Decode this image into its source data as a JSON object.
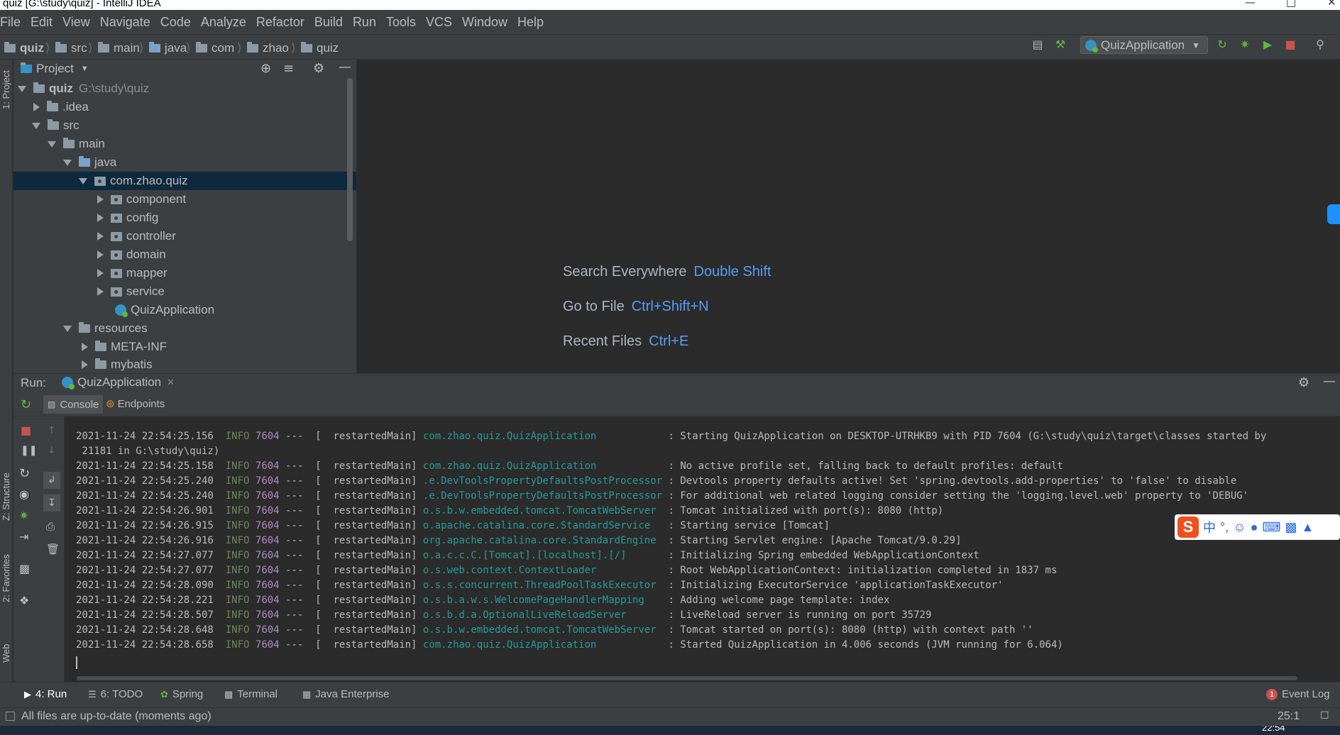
{
  "window": {
    "title": "quiz [G:\\study\\quiz] - IntelliJ IDEA"
  },
  "menu": [
    "File",
    "Edit",
    "View",
    "Navigate",
    "Code",
    "Analyze",
    "Refactor",
    "Build",
    "Run",
    "Tools",
    "VCS",
    "Window",
    "Help"
  ],
  "breadcrumb": [
    "quiz",
    "src",
    "main",
    "java",
    "com",
    "zhao",
    "quiz"
  ],
  "run_config": {
    "name": "QuizApplication"
  },
  "left_stripe": {
    "project": "1: Project",
    "structure": "Z: Structure",
    "favorites": "2: Favorites",
    "web": "Web"
  },
  "project_panel": {
    "title": "Project",
    "tree": [
      {
        "label": "quiz",
        "path": "G:\\study\\quiz"
      },
      {
        "label": ".idea"
      },
      {
        "label": "src"
      },
      {
        "label": "main"
      },
      {
        "label": "java"
      },
      {
        "label": "com.zhao.quiz"
      },
      {
        "label": "component"
      },
      {
        "label": "config"
      },
      {
        "label": "controller"
      },
      {
        "label": "domain"
      },
      {
        "label": "mapper"
      },
      {
        "label": "service"
      },
      {
        "label": "QuizApplication"
      },
      {
        "label": "resources"
      },
      {
        "label": "META-INF"
      },
      {
        "label": "mybatis"
      }
    ]
  },
  "editor_hints": [
    {
      "label": "Search Everywhere",
      "shortcut": "Double Shift"
    },
    {
      "label": "Go to File",
      "shortcut": "Ctrl+Shift+N"
    },
    {
      "label": "Recent Files",
      "shortcut": "Ctrl+E"
    }
  ],
  "run_panel": {
    "label": "Run:",
    "tab": "QuizApplication",
    "subtabs": [
      "Console",
      "Endpoints"
    ]
  },
  "console": [
    {
      "ts": "2021-11-24 22:54:25.156",
      "level": "INFO",
      "pid": "7604",
      "thread": "---  [  restartedMain]",
      "logger": "com.zhao.quiz.QuizApplication",
      "msg": ": Starting QuizApplication on DESKTOP-UTRHKB9 with PID 7604 (G:\\study\\quiz\\target\\classes started by"
    },
    {
      "cont": " 21181 in G:\\study\\quiz)"
    },
    {
      "ts": "2021-11-24 22:54:25.158",
      "level": "INFO",
      "pid": "7604",
      "thread": "---  [  restartedMain]",
      "logger": "com.zhao.quiz.QuizApplication",
      "msg": ": No active profile set, falling back to default profiles: default"
    },
    {
      "ts": "2021-11-24 22:54:25.240",
      "level": "INFO",
      "pid": "7604",
      "thread": "---  [  restartedMain]",
      "logger": ".e.DevToolsPropertyDefaultsPostProcessor",
      "msg": ": Devtools property defaults active! Set 'spring.devtools.add-properties' to 'false' to disable"
    },
    {
      "ts": "2021-11-24 22:54:25.240",
      "level": "INFO",
      "pid": "7604",
      "thread": "---  [  restartedMain]",
      "logger": ".e.DevToolsPropertyDefaultsPostProcessor",
      "msg": ": For additional web related logging consider setting the 'logging.level.web' property to 'DEBUG'"
    },
    {
      "ts": "2021-11-24 22:54:26.901",
      "level": "INFO",
      "pid": "7604",
      "thread": "---  [  restartedMain]",
      "logger": "o.s.b.w.embedded.tomcat.TomcatWebServer",
      "msg": ": Tomcat initialized with port(s): 8080 (http)"
    },
    {
      "ts": "2021-11-24 22:54:26.915",
      "level": "INFO",
      "pid": "7604",
      "thread": "---  [  restartedMain]",
      "logger": "o.apache.catalina.core.StandardService",
      "msg": ": Starting service [Tomcat]"
    },
    {
      "ts": "2021-11-24 22:54:26.916",
      "level": "INFO",
      "pid": "7604",
      "thread": "---  [  restartedMain]",
      "logger": "org.apache.catalina.core.StandardEngine",
      "msg": ": Starting Servlet engine: [Apache Tomcat/9.0.29]"
    },
    {
      "ts": "2021-11-24 22:54:27.077",
      "level": "INFO",
      "pid": "7604",
      "thread": "---  [  restartedMain]",
      "logger": "o.a.c.c.C.[Tomcat].[localhost].[/]",
      "msg": ": Initializing Spring embedded WebApplicationContext"
    },
    {
      "ts": "2021-11-24 22:54:27.077",
      "level": "INFO",
      "pid": "7604",
      "thread": "---  [  restartedMain]",
      "logger": "o.s.web.context.ContextLoader",
      "msg": ": Root WebApplicationContext: initialization completed in 1837 ms"
    },
    {
      "ts": "2021-11-24 22:54:28.090",
      "level": "INFO",
      "pid": "7604",
      "thread": "---  [  restartedMain]",
      "logger": "o.s.s.concurrent.ThreadPoolTaskExecutor",
      "msg": ": Initializing ExecutorService 'applicationTaskExecutor'"
    },
    {
      "ts": "2021-11-24 22:54:28.221",
      "level": "INFO",
      "pid": "7604",
      "thread": "---  [  restartedMain]",
      "logger": "o.s.b.a.w.s.WelcomePageHandlerMapping",
      "msg": ": Adding welcome page template: index"
    },
    {
      "ts": "2021-11-24 22:54:28.507",
      "level": "INFO",
      "pid": "7604",
      "thread": "---  [  restartedMain]",
      "logger": "o.s.b.d.a.OptionalLiveReloadServer",
      "msg": ": LiveReload server is running on port 35729"
    },
    {
      "ts": "2021-11-24 22:54:28.648",
      "level": "INFO",
      "pid": "7604",
      "thread": "---  [  restartedMain]",
      "logger": "o.s.b.w.embedded.tomcat.TomcatWebServer",
      "msg": ": Tomcat started on port(s): 8080 (http) with context path ''"
    },
    {
      "ts": "2021-11-24 22:54:28.658",
      "level": "INFO",
      "pid": "7604",
      "thread": "---  [  restartedMain]",
      "logger": "com.zhao.quiz.QuizApplication",
      "msg": ": Started QuizApplication in 4.006 seconds (JVM running for 6.064)"
    }
  ],
  "bottom_tabs": [
    "4: Run",
    "6: TODO",
    "Spring",
    "Terminal",
    "Java Enterprise"
  ],
  "event_log": {
    "label": "Event Log",
    "count": "1"
  },
  "status": {
    "message": "All files are up-to-date (moments ago)",
    "position": "25:1"
  },
  "ime": {
    "logo": "S",
    "mode": "中"
  },
  "taskbar": {
    "clock": "22:54"
  },
  "colors": {
    "selection": "#0d293e",
    "link": "#589df6",
    "logger": "#299999",
    "info": "#6a8759"
  }
}
